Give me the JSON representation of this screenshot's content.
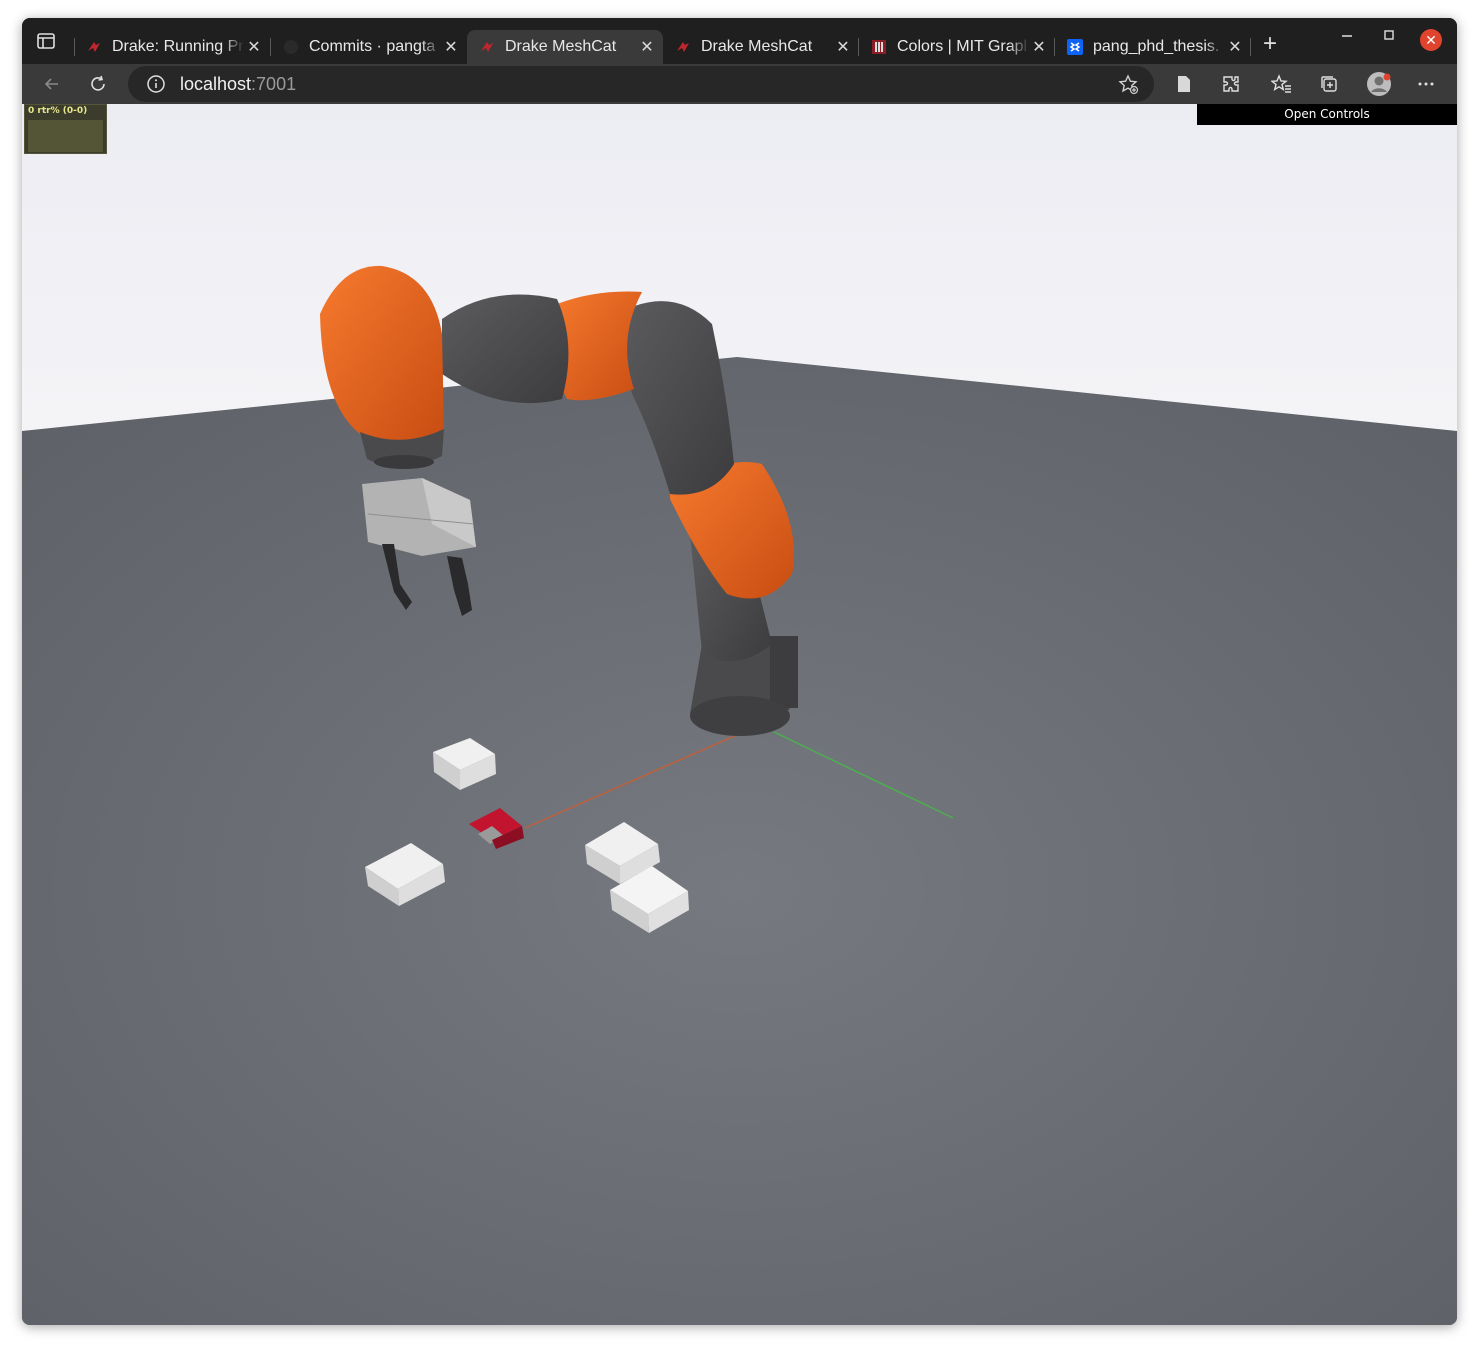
{
  "browser": {
    "tabs": [
      {
        "title": "Drake: Running Pr",
        "favicon": "drake-icon",
        "active": false
      },
      {
        "title": "Commits · pangta",
        "favicon": "github-icon",
        "active": false
      },
      {
        "title": "Drake MeshCat",
        "favicon": "drake-icon",
        "active": true
      },
      {
        "title": "Drake MeshCat",
        "favicon": "drake-icon",
        "active": false
      },
      {
        "title": "Colors | MIT Grapl",
        "favicon": "mit-icon",
        "active": false
      },
      {
        "title": "pang_phd_thesis.",
        "favicon": "dropbox-icon",
        "active": false
      }
    ],
    "close_glyph": "✕",
    "new_tab_glyph": "+",
    "address": {
      "host": "localhost",
      "port": ":7001"
    }
  },
  "viewer": {
    "stats_label": "0 rtr% (0-0)",
    "open_controls_label": "Open Controls"
  },
  "colors": {
    "robot_orange": "#e8601c",
    "robot_gray": "#4d4d4f",
    "floor": "#6a6d73",
    "sky": "#f2f3f6",
    "box_white": "#e6e6e6",
    "target_red": "#b5122e"
  }
}
